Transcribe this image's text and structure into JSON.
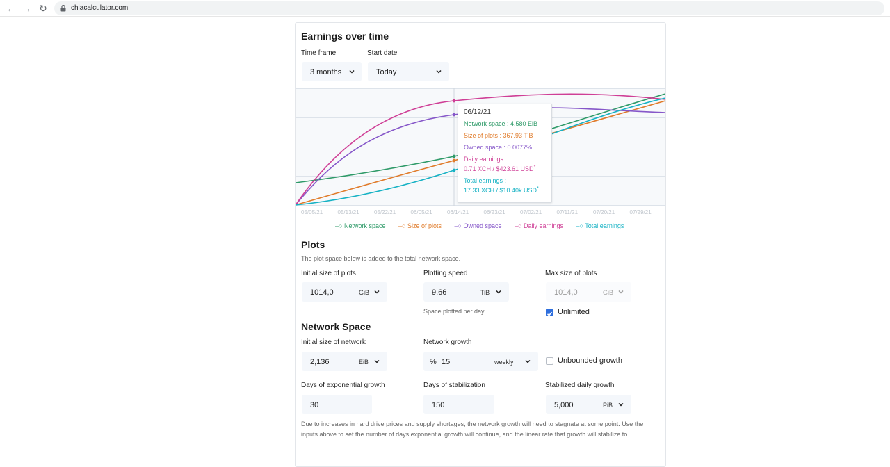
{
  "browser": {
    "url": "chiacalculator.com"
  },
  "earnings": {
    "title": "Earnings over time",
    "timeframe_label": "Time frame",
    "timeframe_value": "3 months",
    "startdate_label": "Start date",
    "startdate_value": "Today"
  },
  "chart_data": {
    "type": "line",
    "x_ticks": [
      "05/05/21",
      "05/13/21",
      "05/22/21",
      "06/05/21",
      "06/14/21",
      "06/23/21",
      "07/02/21",
      "07/11/21",
      "07/20/21",
      "07/29/21"
    ],
    "series": [
      {
        "name": "Network space",
        "color": "#2e9a68"
      },
      {
        "name": "Size of plots",
        "color": "#e07b2a"
      },
      {
        "name": "Owned space",
        "color": "#8657c9"
      },
      {
        "name": "Daily earnings",
        "color": "#cf3f96"
      },
      {
        "name": "Total earnings",
        "color": "#16b2c4"
      }
    ],
    "grid": true,
    "tooltip": {
      "date": "06/12/21",
      "network_space": "Network space : 4.580 EiB",
      "size_of_plots": "Size of plots : 367.93 TiB",
      "owned_space": "Owned space : 0.0077%",
      "daily_earnings_label": "Daily earnings :",
      "daily_earnings_value": "0.71 XCH / $423.61 USD",
      "total_earnings_label": "Total earnings :",
      "total_earnings_value": "17.33 XCH / $10.40k USD",
      "asterisk": "*"
    }
  },
  "plots": {
    "title": "Plots",
    "description": "The plot space below is added to the total network space.",
    "initial_label": "Initial size of plots",
    "initial_value": "1014,0",
    "initial_unit": "GiB",
    "speed_label": "Plotting speed",
    "speed_value": "9,66",
    "speed_unit": "TiB",
    "speed_sub": "Space plotted per day",
    "max_label": "Max size of plots",
    "max_value": "1014,0",
    "max_unit": "GiB",
    "unlimited_label": "Unlimited",
    "unlimited_checked": true
  },
  "network": {
    "title": "Network Space",
    "initial_label": "Initial size of network",
    "initial_value": "2,136",
    "initial_unit": "EiB",
    "growth_label": "Network growth",
    "growth_prefix": "%",
    "growth_value": "15",
    "growth_period": "weekly",
    "unbounded_label": "Unbounded growth",
    "unbounded_checked": false,
    "exp_days_label": "Days of exponential growth",
    "exp_days_value": "30",
    "stab_days_label": "Days of stabilization",
    "stab_days_value": "150",
    "stab_growth_label": "Stabilized daily growth",
    "stab_growth_value": "5,000",
    "stab_growth_unit": "PiB",
    "note": "Due to increases in hard drive prices and supply shortages, the network growth will need to stagnate at some point. Use the inputs above to set the number of days exponential growth will continue, and the linear rate that growth will stabilize to."
  }
}
